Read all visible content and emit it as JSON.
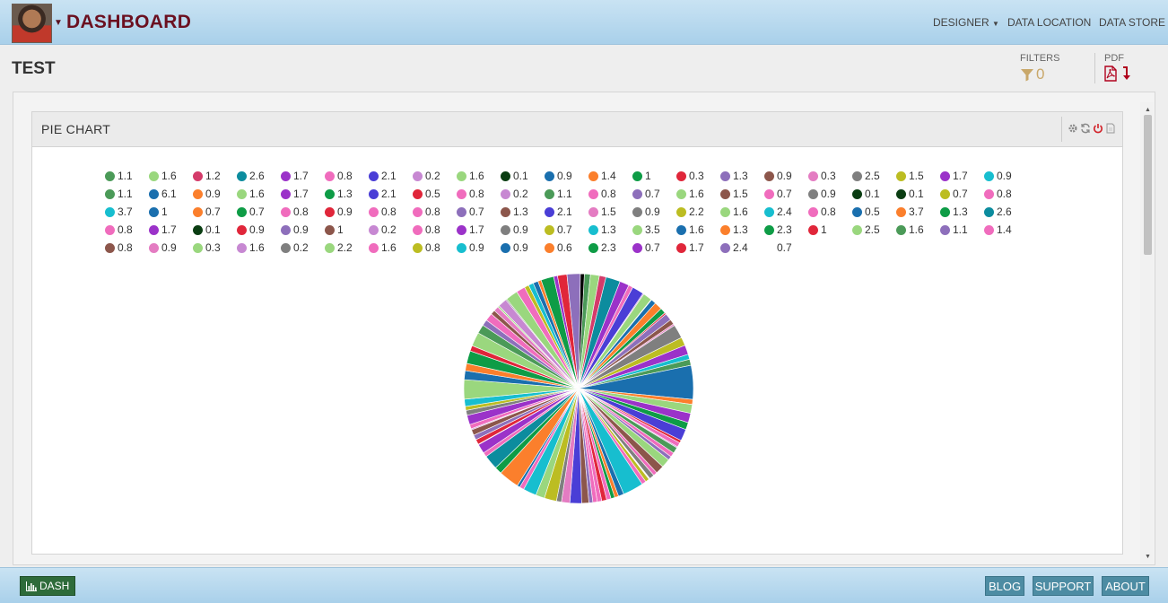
{
  "app": {
    "title": "DASHBOARD"
  },
  "nav": {
    "designer": "DESIGNER",
    "data_location": "DATA LOCATION",
    "data_store": "DATA STORE"
  },
  "page": {
    "title": "TEST",
    "filters_label": "FILTERS",
    "filters_count": "0",
    "pdf_label": "PDF"
  },
  "widget": {
    "title": "PIE CHART"
  },
  "footer": {
    "dash": "DASH",
    "blog": "BLOG",
    "support": "SUPPORT",
    "about": "ABOUT"
  },
  "colors": {
    "header_bg": "#b8daf0",
    "title": "#6b1020",
    "filter_accent": "#c9a86a",
    "pdf_red": "#b0001d",
    "dash_green": "#2e6b3a",
    "footer_btn": "#4d8ca3"
  },
  "chart_data": {
    "type": "pie",
    "title": "",
    "legend_position": "top",
    "palette": [
      "#4b9a58",
      "#6baed6",
      "#9ad77e",
      "#d43b6a",
      "#0c8c9e",
      "#9b32c9",
      "#f06cbd",
      "#4a3ed6",
      "#c788d2",
      "#0a3d12",
      "#1a6fae",
      "#fb7f2c",
      "#0e9c46",
      "#e0263a",
      "#8d6fbb",
      "#8c564b",
      "#e47cc2",
      "#7f7f7f",
      "#bcbd22",
      "#17becf"
    ],
    "series": [
      {
        "values": [
          1.1,
          1.6,
          1.2,
          2.6,
          1.7,
          0.8,
          2.1,
          0.2,
          1.6,
          0.1,
          0.9,
          1.4,
          1.0,
          0.3,
          1.3,
          0.9,
          0.3,
          2.5,
          1.5,
          1.7,
          0.9,
          1.1,
          6.1,
          0.9,
          1.6,
          1.7,
          1.3,
          2.1,
          0.5,
          0.8,
          0.2,
          1.1,
          0.8,
          0.7,
          1.6,
          1.5,
          0.7,
          0.9,
          0.1,
          0.1,
          0.7,
          0.8,
          3.7,
          1.0,
          0.7,
          0.7,
          0.8,
          0.9,
          0.8,
          0.8,
          0.7,
          1.3,
          2.1,
          1.5,
          0.9,
          2.2,
          1.6,
          2.4,
          0.8,
          0.5,
          3.7,
          1.3,
          2.6,
          0.8,
          1.7,
          0.1,
          0.9,
          0.9,
          1.0,
          0.2,
          0.8,
          1.7,
          0.9,
          0.7,
          1.3,
          3.5,
          1.6,
          1.3,
          2.3,
          1.0,
          2.5,
          1.6,
          1.1,
          1.4,
          0.8,
          0.9,
          0.3,
          1.6,
          0.2,
          2.2,
          1.6,
          0.8,
          0.9,
          0.9,
          0.6,
          2.3,
          0.7,
          1.7,
          2.4,
          0.7
        ],
        "colors": [
          "#4b9a58",
          "#9ad77e",
          "#d43b6a",
          "#0c8c9e",
          "#9b32c9",
          "#f06cbd",
          "#4a3ed6",
          "#c788d2",
          "#9ad77e",
          "#0a3d12",
          "#1a6fae",
          "#fb7f2c",
          "#0e9c46",
          "#e0263a",
          "#8d6fbb",
          "#8c564b",
          "#e47cc2",
          "#7f7f7f",
          "#bcbd22",
          "#9b32c9",
          "#17becf",
          "#4b9a58",
          "#1a6fae",
          "#fb7f2c",
          "#9ad77e",
          "#9b32c9",
          "#0e9c46",
          "#4a3ed6",
          "#e0263a",
          "#f06cbd",
          "#c788d2",
          "#4b9a58",
          "#f06cbd",
          "#8d6fbb",
          "#9ad77e",
          "#8c564b",
          "#f06cbd",
          "#7f7f7f",
          "#0a3d12",
          "#0a3d12",
          "#bcbd22",
          "#f06cbd",
          "#17becf",
          "#1a6fae",
          "#fb7f2c",
          "#0e9c46",
          "#f06cbd",
          "#e0263a",
          "#f06cbd",
          "#f06cbd",
          "#8d6fbb",
          "#8c564b",
          "#4a3ed6",
          "#e47cc2",
          "#7f7f7f",
          "#bcbd22",
          "#9ad77e",
          "#17becf",
          "#f06cbd",
          "#1a6fae",
          "#fb7f2c",
          "#0e9c46",
          "#0c8c9e",
          "#f06cbd",
          "#9b32c9",
          "#0a3d12",
          "#e0263a",
          "#8d6fbb",
          "#8c564b",
          "#c788d2",
          "#f06cbd",
          "#9b32c9",
          "#7f7f7f",
          "#bcbd22",
          "#17becf",
          "#9ad77e",
          "#1a6fae",
          "#fb7f2c",
          "#0e9c46",
          "#e0263a",
          "#9ad77e",
          "#4b9a58",
          "#8d6fbb",
          "#f06cbd",
          "#8c564b",
          "#e47cc2",
          "#9ad77e",
          "#c788d2",
          "#7f7f7f",
          "#9ad77e",
          "#f06cbd",
          "#bcbd22",
          "#17becf",
          "#1a6fae",
          "#fb7f2c",
          "#0e9c46",
          "#9b32c9",
          "#e0263a",
          "#8d6fbb"
        ]
      }
    ]
  }
}
